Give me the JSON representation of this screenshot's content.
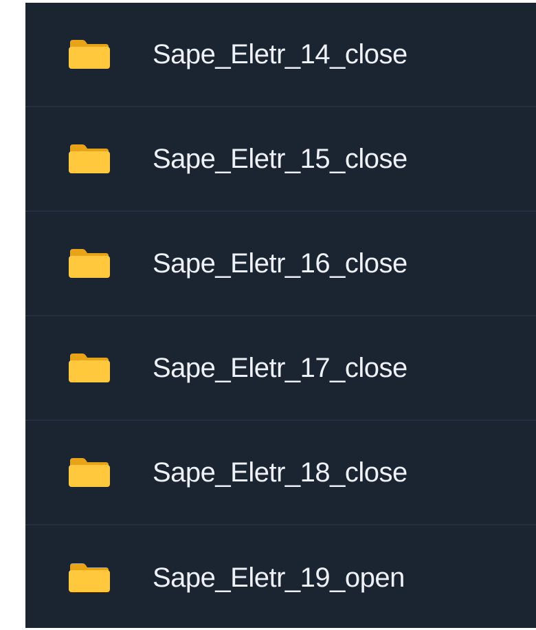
{
  "folder_list": {
    "items": [
      {
        "name": "Sape_Eletr_14_close",
        "icon": "folder-icon"
      },
      {
        "name": "Sape_Eletr_15_close",
        "icon": "folder-icon"
      },
      {
        "name": "Sape_Eletr_16_close",
        "icon": "folder-icon"
      },
      {
        "name": "Sape_Eletr_17_close",
        "icon": "folder-icon"
      },
      {
        "name": "Sape_Eletr_18_close",
        "icon": "folder-icon"
      },
      {
        "name": "Sape_Eletr_19_open",
        "icon": "folder-icon"
      }
    ]
  },
  "colors": {
    "background": "#1b2431",
    "divider": "#243042",
    "text": "#eef1f5",
    "folder_front": "#ffc83d",
    "folder_back": "#e8a317"
  }
}
